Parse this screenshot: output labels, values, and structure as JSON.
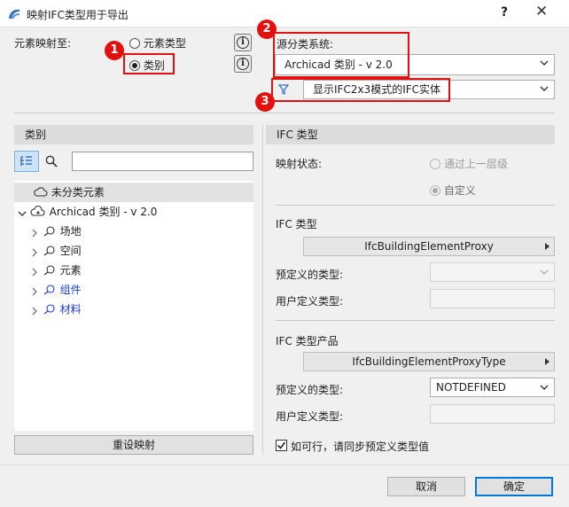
{
  "window": {
    "title": "映射IFC类型用于导出",
    "help": "?",
    "close": "✕"
  },
  "map_to": {
    "label": "元素映射至:",
    "option_element_type": "元素类型",
    "option_category": "类别",
    "selected": "类别"
  },
  "source": {
    "label": "源分类系统:",
    "value": "Archicad 类别 - v 2.0",
    "filter_value": "显示IFC2x3模式的IFC实体"
  },
  "callouts": [
    "1",
    "2",
    "3"
  ],
  "left_panel": {
    "header": "类别",
    "search_placeholder": "",
    "unclassified": "未分类元素",
    "tree_root": "Archicad 类别 - v 2.0",
    "tree_items": [
      "场地",
      "空间",
      "元素",
      "组件",
      "材料"
    ],
    "reset_button": "重设映射"
  },
  "right_panel": {
    "header": "IFC 类型",
    "mapping_status_label": "映射状态:",
    "status_inherit": "通过上一层级",
    "status_custom": "自定义",
    "ifc_type_section": "IFC 类型",
    "ifc_type_value": "IfcBuildingElementProxy",
    "predefined_label_1": "预定义的类型:",
    "predefined_value_1": "",
    "user_defined_label_1": "用户定义类型:",
    "user_defined_value_1": "",
    "ifc_type_product_section": "IFC 类型产品",
    "ifc_type_product_value": "IfcBuildingElementProxyType",
    "predefined_label_2": "预定义的类型:",
    "predefined_value_2": "NOTDEFINED",
    "user_defined_label_2": "用户定义类型:",
    "user_defined_value_2": "",
    "sync_checkbox_label": "如可行，请同步预定义类型值",
    "sync_checked": true
  },
  "footer": {
    "cancel": "取消",
    "ok": "确定"
  },
  "colors": {
    "callout": "#e31010",
    "default_button_border": "#0078d7",
    "link_blue": "#1e3cd2"
  }
}
